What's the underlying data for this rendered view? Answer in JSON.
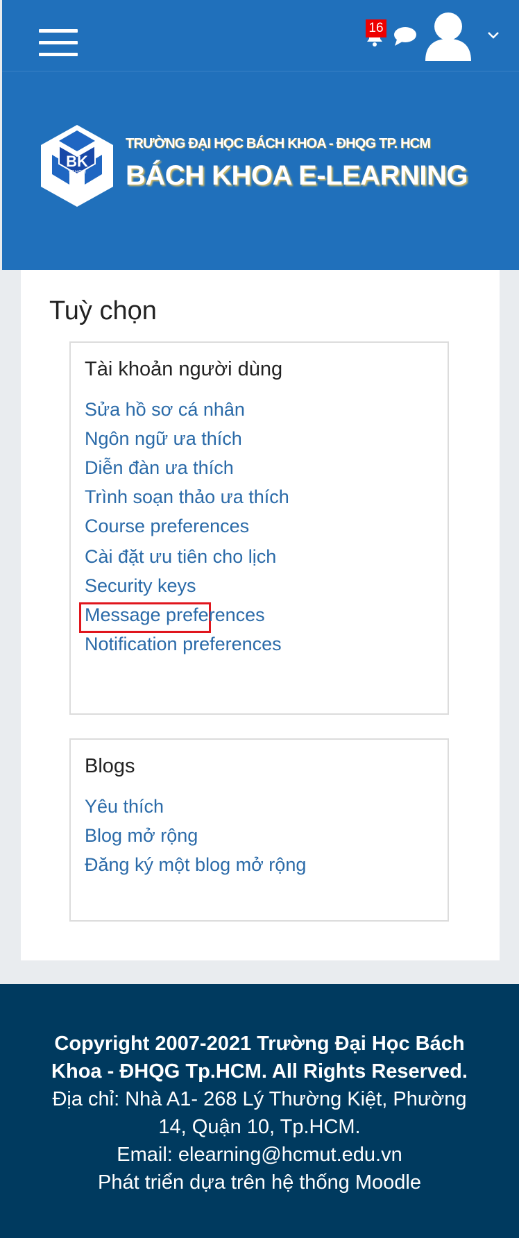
{
  "navbar": {
    "notification_count": "16",
    "icons": [
      "hamburger-menu-icon",
      "bell-icon",
      "chat-icon",
      "user-avatar-icon",
      "chevron-down-icon"
    ]
  },
  "banner": {
    "subtitle": "TRƯỜNG ĐẠI HỌC BÁCH KHOA - ĐHQG TP. HCM",
    "title": "BÁCH KHOA E-LEARNING",
    "logo_text": "BK",
    "logo_subtext": "TP.HCM"
  },
  "main": {
    "page_title": "Tuỳ chọn",
    "sections": [
      {
        "title": "Tài khoản người dùng",
        "links": [
          "Sửa hồ sơ cá nhân",
          "Ngôn ngữ ưa thích",
          "Diễn đàn ưa thích",
          "Trình soạn thảo ưa thích",
          "Course preferences",
          "Cài đặt ưu tiên cho lịch",
          "Security keys",
          "Message preferences",
          "Notification preferences"
        ]
      },
      {
        "title": "Blogs",
        "links": [
          "Yêu thích",
          "Blog mở rộng",
          "Đăng ký một blog mở rộng"
        ]
      }
    ]
  },
  "footer": {
    "line1": "Copyright 2007-2021 Trường Đại Học Bách",
    "line2": "Khoa - ĐHQG Tp.HCM. All Rights Reserved.",
    "line3": "Địa chỉ: Nhà A1- 268 Lý Thường Kiệt, Phường",
    "line4": "14, Quận 10, Tp.HCM.",
    "line5": "Email: elearning@hcmut.edu.vn",
    "line6": "Phát triển dựa trên hệ thống Moodle"
  },
  "colors": {
    "navbar": "#2070bb",
    "link": "#2a6aa8",
    "footer": "#003a5f",
    "highlight": "#e0161d",
    "badge": "#ee0000"
  }
}
